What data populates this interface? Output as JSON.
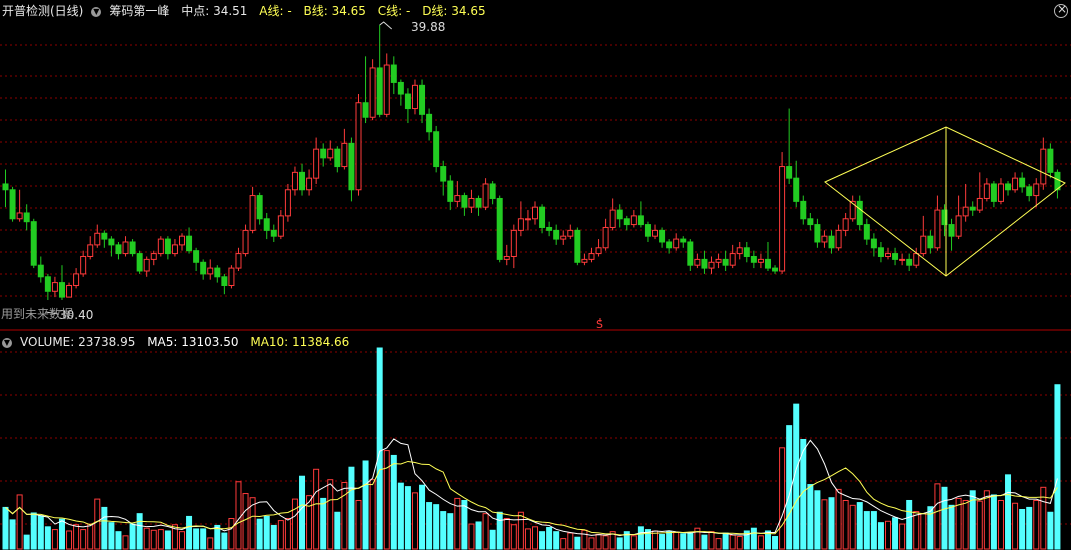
{
  "header": {
    "indicator1": "开普检测(日线)",
    "indicator2": "筹码第一峰",
    "midpoint_label": "中点: 34.51",
    "a_line": "A线: -",
    "b_line": "B线: 34.65",
    "c_line": "C线: -",
    "d_line": "D线: 34.65"
  },
  "annotations": {
    "high_price": "39.88",
    "low_price": "30.40",
    "future_hint": "用到未来数据",
    "s_marker": "S"
  },
  "volume_header": {
    "volume": "VOLUME: 23738.95",
    "ma5": "MA5: 13103.50",
    "ma10": "MA10: 11384.66"
  },
  "colors": {
    "up": "#ff3b3b",
    "down": "#54ffff",
    "down_candle": "#22cc22",
    "grid": "#8b0000",
    "ma5": "#ffffff",
    "ma10": "#ffff55",
    "yellow": "#ffff55",
    "text_label": "#dcdcdc"
  },
  "chart_data": {
    "type": "candlestick",
    "price_high": 39.88,
    "price_low": 30.4,
    "candles": [
      [
        34.4,
        34.2,
        34.9,
        33.6
      ],
      [
        34.2,
        33.2,
        34.3,
        33.1
      ],
      [
        33.2,
        33.4,
        34.2,
        33.1
      ],
      [
        33.4,
        33.1,
        33.7,
        32.8
      ],
      [
        33.1,
        31.6,
        33.2,
        31.5
      ],
      [
        31.6,
        31.2,
        31.9,
        31.0
      ],
      [
        31.2,
        30.7,
        31.3,
        30.4
      ],
      [
        30.7,
        31.0,
        31.2,
        30.5
      ],
      [
        31.0,
        30.5,
        31.6,
        30.4
      ],
      [
        30.5,
        30.9,
        31.0,
        30.5
      ],
      [
        30.9,
        31.3,
        31.5,
        30.8
      ],
      [
        31.3,
        31.9,
        32.1,
        31.2
      ],
      [
        31.9,
        32.3,
        32.6,
        31.8
      ],
      [
        32.3,
        32.7,
        33.0,
        32.2
      ],
      [
        32.7,
        32.5,
        32.8,
        32.2
      ],
      [
        32.5,
        32.3,
        32.6,
        31.9
      ],
      [
        32.3,
        32.0,
        32.4,
        31.8
      ],
      [
        32.0,
        32.4,
        32.6,
        31.9
      ],
      [
        32.4,
        32.0,
        32.5,
        31.9
      ],
      [
        32.0,
        31.4,
        32.1,
        31.3
      ],
      [
        31.4,
        31.8,
        31.9,
        31.2
      ],
      [
        31.8,
        32.0,
        32.1,
        31.6
      ],
      [
        32.0,
        32.5,
        32.6,
        31.9
      ],
      [
        32.5,
        32.0,
        32.6,
        31.8
      ],
      [
        32.0,
        32.3,
        32.5,
        31.9
      ],
      [
        32.3,
        32.6,
        32.7,
        32.1
      ],
      [
        32.6,
        32.1,
        32.9,
        32.0
      ],
      [
        32.1,
        31.7,
        32.2,
        31.4
      ],
      [
        31.7,
        31.3,
        31.8,
        31.1
      ],
      [
        31.3,
        31.5,
        31.8,
        31.1
      ],
      [
        31.5,
        31.2,
        31.6,
        31.0
      ],
      [
        31.2,
        30.9,
        31.3,
        30.6
      ],
      [
        30.9,
        31.5,
        31.6,
        30.8
      ],
      [
        31.5,
        32.0,
        32.2,
        31.4
      ],
      [
        32.0,
        32.8,
        33.0,
        31.9
      ],
      [
        32.8,
        34.0,
        34.3,
        32.7
      ],
      [
        34.0,
        33.2,
        34.1,
        33.0
      ],
      [
        33.2,
        32.8,
        33.4,
        32.5
      ],
      [
        32.8,
        32.6,
        33.0,
        32.4
      ],
      [
        32.6,
        33.3,
        33.5,
        32.5
      ],
      [
        33.3,
        34.2,
        34.4,
        33.1
      ],
      [
        34.2,
        34.8,
        35.0,
        34.0
      ],
      [
        34.8,
        34.2,
        35.1,
        34.0
      ],
      [
        34.2,
        34.6,
        34.9,
        34.0
      ],
      [
        34.6,
        35.6,
        36.0,
        34.4
      ],
      [
        35.6,
        35.3,
        35.8,
        35.0
      ],
      [
        35.3,
        35.6,
        35.9,
        35.2
      ],
      [
        35.6,
        35.0,
        35.7,
        34.8
      ],
      [
        35.0,
        35.8,
        36.3,
        34.9
      ],
      [
        35.8,
        34.2,
        36.0,
        33.8
      ],
      [
        34.2,
        37.2,
        37.5,
        34.0
      ],
      [
        37.2,
        36.7,
        38.8,
        36.5
      ],
      [
        36.7,
        38.4,
        38.7,
        36.6
      ],
      [
        38.4,
        36.8,
        39.88,
        36.7
      ],
      [
        36.8,
        38.5,
        38.9,
        36.7
      ],
      [
        38.5,
        37.9,
        38.8,
        37.5
      ],
      [
        37.9,
        37.5,
        38.0,
        37.1
      ],
      [
        37.5,
        37.0,
        37.7,
        36.5
      ],
      [
        37.0,
        37.8,
        38.0,
        36.8
      ],
      [
        37.8,
        36.8,
        38.0,
        36.5
      ],
      [
        36.8,
        36.2,
        37.0,
        35.9
      ],
      [
        36.2,
        35.0,
        36.4,
        34.8
      ],
      [
        35.0,
        34.5,
        35.2,
        34.0
      ],
      [
        34.5,
        33.8,
        34.7,
        33.5
      ],
      [
        33.8,
        34.0,
        34.5,
        33.6
      ],
      [
        34.0,
        33.6,
        34.1,
        33.3
      ],
      [
        33.6,
        33.9,
        34.2,
        33.4
      ],
      [
        33.9,
        33.6,
        34.0,
        33.3
      ],
      [
        33.6,
        34.4,
        34.6,
        33.5
      ],
      [
        34.4,
        33.9,
        34.5,
        33.7
      ],
      [
        33.9,
        31.8,
        34.0,
        31.7
      ],
      [
        31.8,
        31.9,
        32.3,
        31.6
      ],
      [
        31.9,
        32.8,
        33.0,
        31.5
      ],
      [
        32.8,
        33.2,
        33.8,
        32.6
      ],
      [
        33.2,
        33.2,
        33.5,
        32.8
      ],
      [
        33.2,
        33.6,
        33.8,
        33.0
      ],
      [
        33.6,
        32.9,
        33.7,
        32.7
      ],
      [
        32.9,
        32.8,
        33.1,
        32.6
      ],
      [
        32.8,
        32.5,
        33.0,
        32.3
      ],
      [
        32.5,
        32.6,
        32.8,
        32.3
      ],
      [
        32.6,
        32.8,
        33.0,
        32.5
      ],
      [
        32.8,
        31.7,
        32.9,
        31.6
      ],
      [
        31.7,
        31.8,
        32.0,
        31.6
      ],
      [
        31.8,
        32.0,
        32.2,
        31.7
      ],
      [
        32.0,
        32.2,
        32.5,
        31.9
      ],
      [
        32.2,
        32.9,
        33.2,
        32.1
      ],
      [
        32.9,
        33.5,
        33.9,
        32.8
      ],
      [
        33.5,
        33.2,
        33.7,
        32.9
      ],
      [
        33.2,
        33.0,
        33.3,
        32.8
      ],
      [
        33.0,
        33.3,
        33.5,
        32.9
      ],
      [
        33.3,
        33.0,
        33.8,
        32.9
      ],
      [
        33.0,
        32.6,
        33.1,
        32.4
      ],
      [
        32.6,
        32.8,
        33.0,
        32.5
      ],
      [
        32.8,
        32.4,
        32.9,
        32.2
      ],
      [
        32.4,
        32.2,
        32.5,
        32.0
      ],
      [
        32.2,
        32.5,
        32.7,
        32.1
      ],
      [
        32.5,
        32.4,
        32.6,
        32.2
      ],
      [
        32.4,
        31.6,
        32.5,
        31.4
      ],
      [
        31.6,
        31.8,
        32.0,
        31.5
      ],
      [
        31.8,
        31.5,
        32.1,
        31.3
      ],
      [
        31.5,
        31.7,
        31.9,
        31.3
      ],
      [
        31.7,
        31.8,
        32.0,
        31.5
      ],
      [
        31.8,
        31.6,
        32.1,
        31.4
      ],
      [
        31.6,
        32.0,
        32.3,
        31.5
      ],
      [
        32.0,
        32.2,
        32.4,
        31.8
      ],
      [
        32.2,
        31.9,
        32.4,
        31.7
      ],
      [
        31.9,
        31.7,
        32.1,
        31.5
      ],
      [
        31.7,
        31.8,
        32.0,
        31.5
      ],
      [
        31.8,
        31.5,
        32.4,
        31.4
      ],
      [
        31.5,
        31.4,
        31.6,
        31.3
      ],
      [
        31.4,
        35.0,
        35.5,
        31.3
      ],
      [
        35.0,
        34.6,
        37.0,
        34.4
      ],
      [
        34.6,
        33.8,
        35.2,
        33.6
      ],
      [
        33.8,
        33.2,
        34.0,
        33.0
      ],
      [
        33.2,
        33.0,
        33.4,
        32.8
      ],
      [
        33.0,
        32.4,
        33.2,
        32.2
      ],
      [
        32.4,
        32.6,
        32.8,
        32.2
      ],
      [
        32.6,
        32.2,
        32.8,
        32.0
      ],
      [
        32.2,
        32.8,
        33.0,
        32.1
      ],
      [
        32.8,
        33.2,
        33.4,
        32.6
      ],
      [
        33.2,
        33.8,
        34.0,
        33.1
      ],
      [
        33.8,
        33.0,
        34.0,
        32.8
      ],
      [
        33.0,
        32.5,
        33.2,
        32.3
      ],
      [
        32.5,
        32.2,
        32.7,
        31.9
      ],
      [
        32.2,
        31.9,
        32.4,
        31.7
      ],
      [
        31.9,
        32.0,
        32.2,
        31.8
      ],
      [
        32.0,
        31.8,
        32.2,
        31.6
      ],
      [
        31.8,
        31.8,
        32.0,
        31.6
      ],
      [
        31.8,
        31.6,
        32.0,
        31.4
      ],
      [
        31.6,
        32.0,
        32.2,
        31.5
      ],
      [
        32.0,
        32.6,
        33.3,
        31.9
      ],
      [
        32.6,
        32.2,
        32.8,
        32.0
      ],
      [
        32.2,
        33.5,
        34.0,
        32.1
      ],
      [
        33.5,
        33.0,
        33.7,
        32.6
      ],
      [
        33.0,
        32.6,
        33.2,
        32.1
      ],
      [
        32.6,
        33.3,
        34.0,
        32.5
      ],
      [
        33.3,
        33.6,
        34.4,
        33.1
      ],
      [
        33.6,
        33.5,
        33.8,
        33.3
      ],
      [
        33.5,
        33.9,
        34.8,
        33.4
      ],
      [
        33.9,
        34.4,
        34.6,
        33.8
      ],
      [
        34.4,
        33.8,
        34.5,
        33.6
      ],
      [
        33.8,
        34.4,
        34.6,
        33.7
      ],
      [
        34.4,
        34.2,
        34.5,
        34.0
      ],
      [
        34.2,
        34.6,
        34.8,
        34.1
      ],
      [
        34.6,
        34.3,
        34.8,
        34.1
      ],
      [
        34.3,
        34.0,
        34.4,
        33.8
      ],
      [
        34.0,
        34.4,
        34.6,
        33.6
      ],
      [
        34.4,
        35.6,
        36.0,
        34.2
      ],
      [
        35.6,
        34.8,
        35.8,
        34.6
      ],
      [
        34.8,
        34.2,
        34.9,
        33.9
      ]
    ],
    "volumes": [
      6000,
      4200,
      7800,
      2000,
      5200,
      4800,
      3200,
      2800,
      4300,
      2600,
      3500,
      2800,
      3600,
      7200,
      6000,
      3800,
      2500,
      1900,
      3600,
      5100,
      3000,
      2700,
      2800,
      2600,
      3500,
      2500,
      4700,
      2900,
      2900,
      1600,
      3400,
      2300,
      4400,
      9700,
      8000,
      7400,
      4300,
      4700,
      3400,
      4100,
      4400,
      7200,
      10500,
      7700,
      11500,
      7300,
      10000,
      5300,
      9600,
      11800,
      7000,
      12700,
      10000,
      29000,
      14200,
      13500,
      9500,
      9000,
      8100,
      9200,
      6700,
      6400,
      5400,
      5100,
      7300,
      7000,
      3600,
      3900,
      5100,
      2700,
      5300,
      4400,
      3500,
      5300,
      2900,
      3200,
      2500,
      3100,
      2500,
      1500,
      2300,
      1700,
      2700,
      1600,
      2100,
      1900,
      2500,
      1600,
      2500,
      1900,
      3200,
      2800,
      2600,
      2100,
      2500,
      2400,
      2200,
      2300,
      3000,
      2000,
      2500,
      1500,
      2300,
      2000,
      1800,
      2600,
      3000,
      1900,
      2600,
      1800,
      14600,
      17800,
      20900,
      15800,
      9300,
      8400,
      7100,
      7400,
      8600,
      7000,
      6300,
      6700,
      5400,
      5400,
      3800,
      4000,
      4500,
      3600,
      7000,
      5400,
      5100,
      6100,
      9400,
      8900,
      6300,
      7300,
      7000,
      8400,
      6900,
      8400,
      7800,
      7000,
      10700,
      6600,
      5700,
      6000,
      7000,
      8900,
      5300,
      23700
    ]
  }
}
